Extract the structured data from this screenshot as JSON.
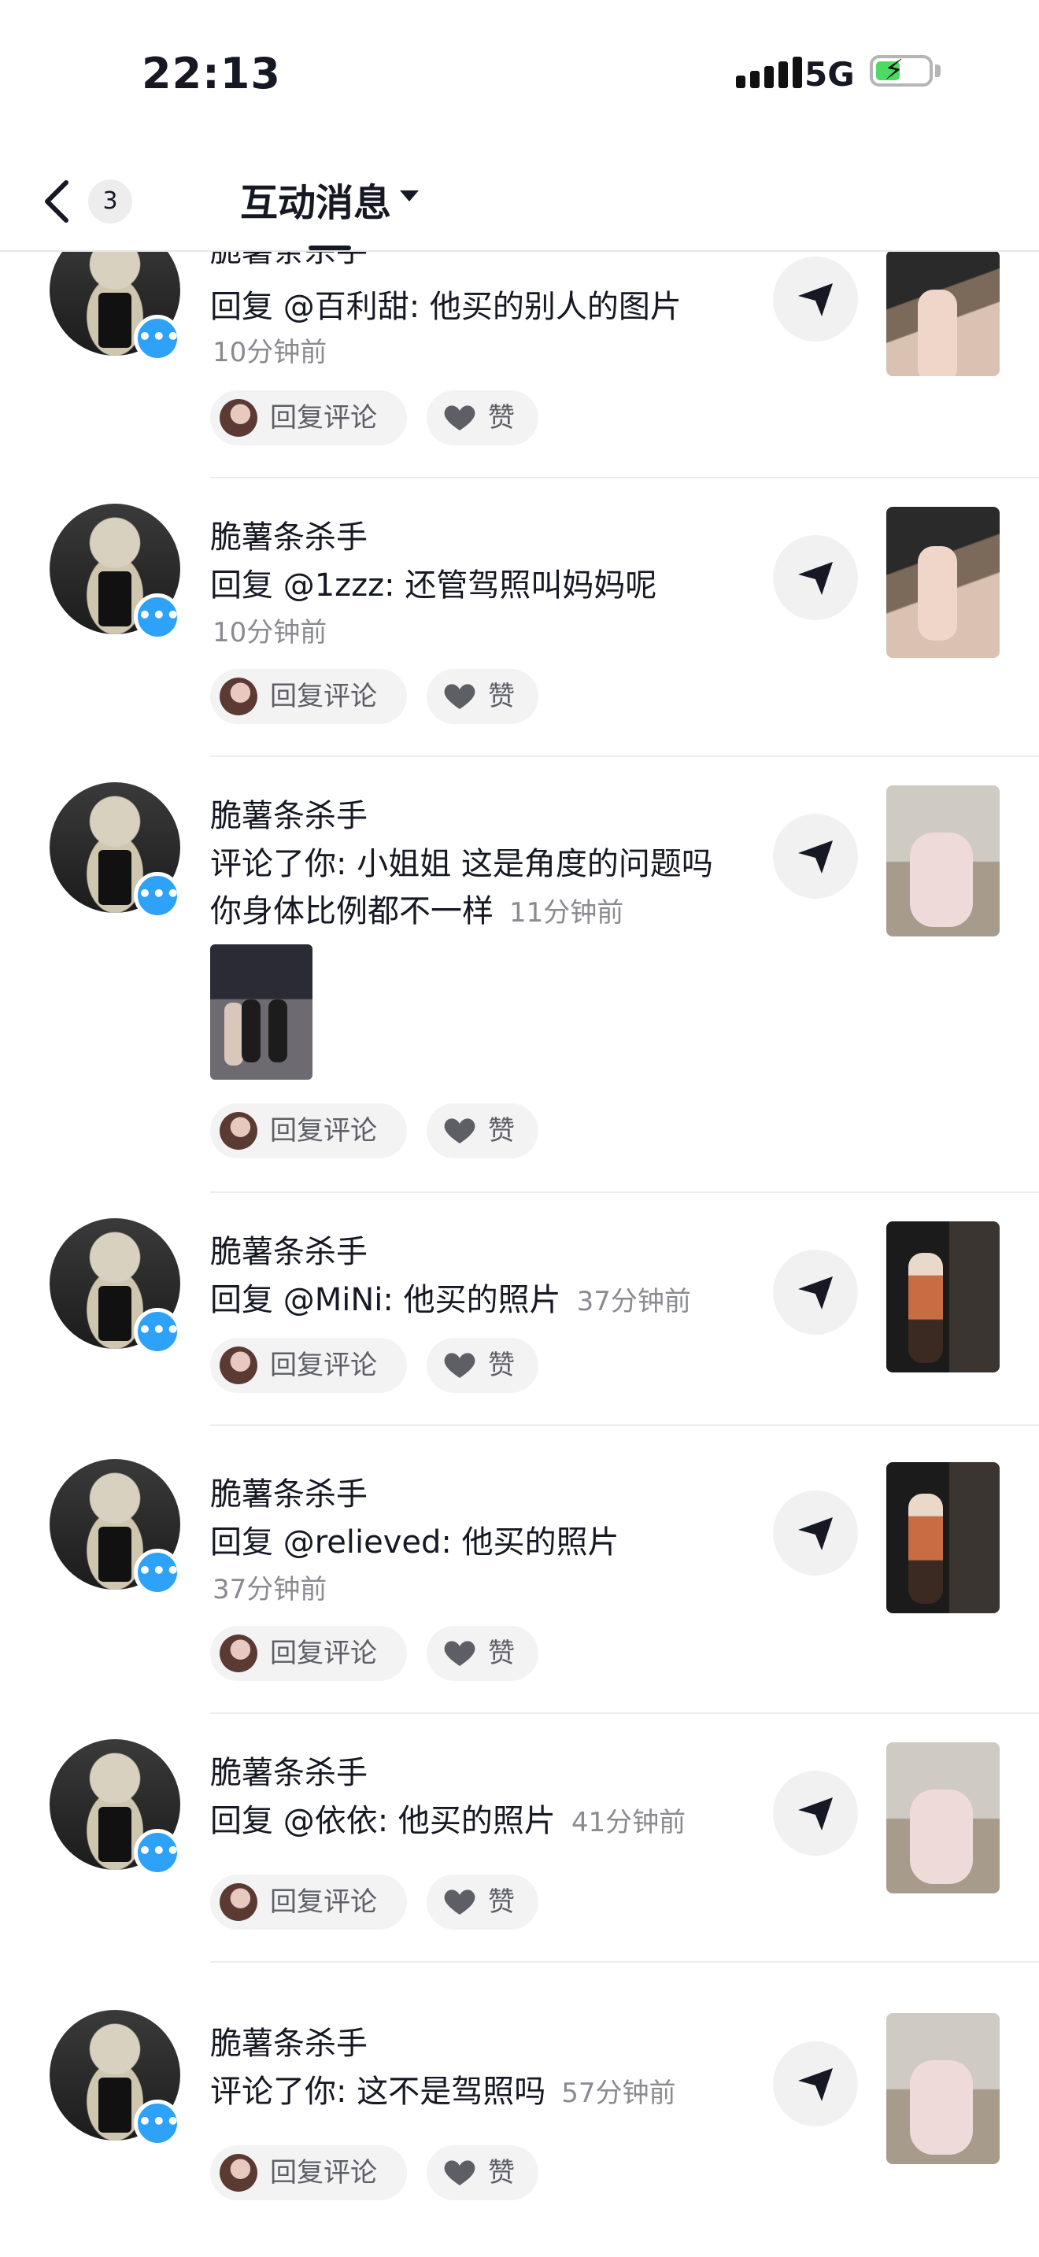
{
  "status_bar": {
    "time": "22:13",
    "network": "5G"
  },
  "nav": {
    "back_badge": "3",
    "title": "互动消息"
  },
  "reply_label": "回复评论",
  "like_label": "赞",
  "items": [
    {
      "name": "脆薯条杀手",
      "text": "回复 @百利甜: 他买的别人的图片",
      "time": "10分钟前"
    },
    {
      "name": "脆薯条杀手",
      "text": "回复 @1zzz: 还管驾照叫妈妈呢",
      "time": "10分钟前"
    },
    {
      "name": "脆薯条杀手",
      "text": "评论了你: 小姐姐 这是角度的问题吗你身体比例都不一样",
      "time": "11分钟前"
    },
    {
      "name": "脆薯条杀手",
      "text": "回复 @MiNi: 他买的照片",
      "time": "37分钟前"
    },
    {
      "name": "脆薯条杀手",
      "text": "回复 @relieved: 他买的照片",
      "time": "37分钟前"
    },
    {
      "name": "脆薯条杀手",
      "text": "回复 @依依: 他买的照片",
      "time": "41分钟前"
    },
    {
      "name": "脆薯条杀手",
      "text": "评论了你: 这不是驾照吗",
      "time": "57分钟前"
    }
  ]
}
